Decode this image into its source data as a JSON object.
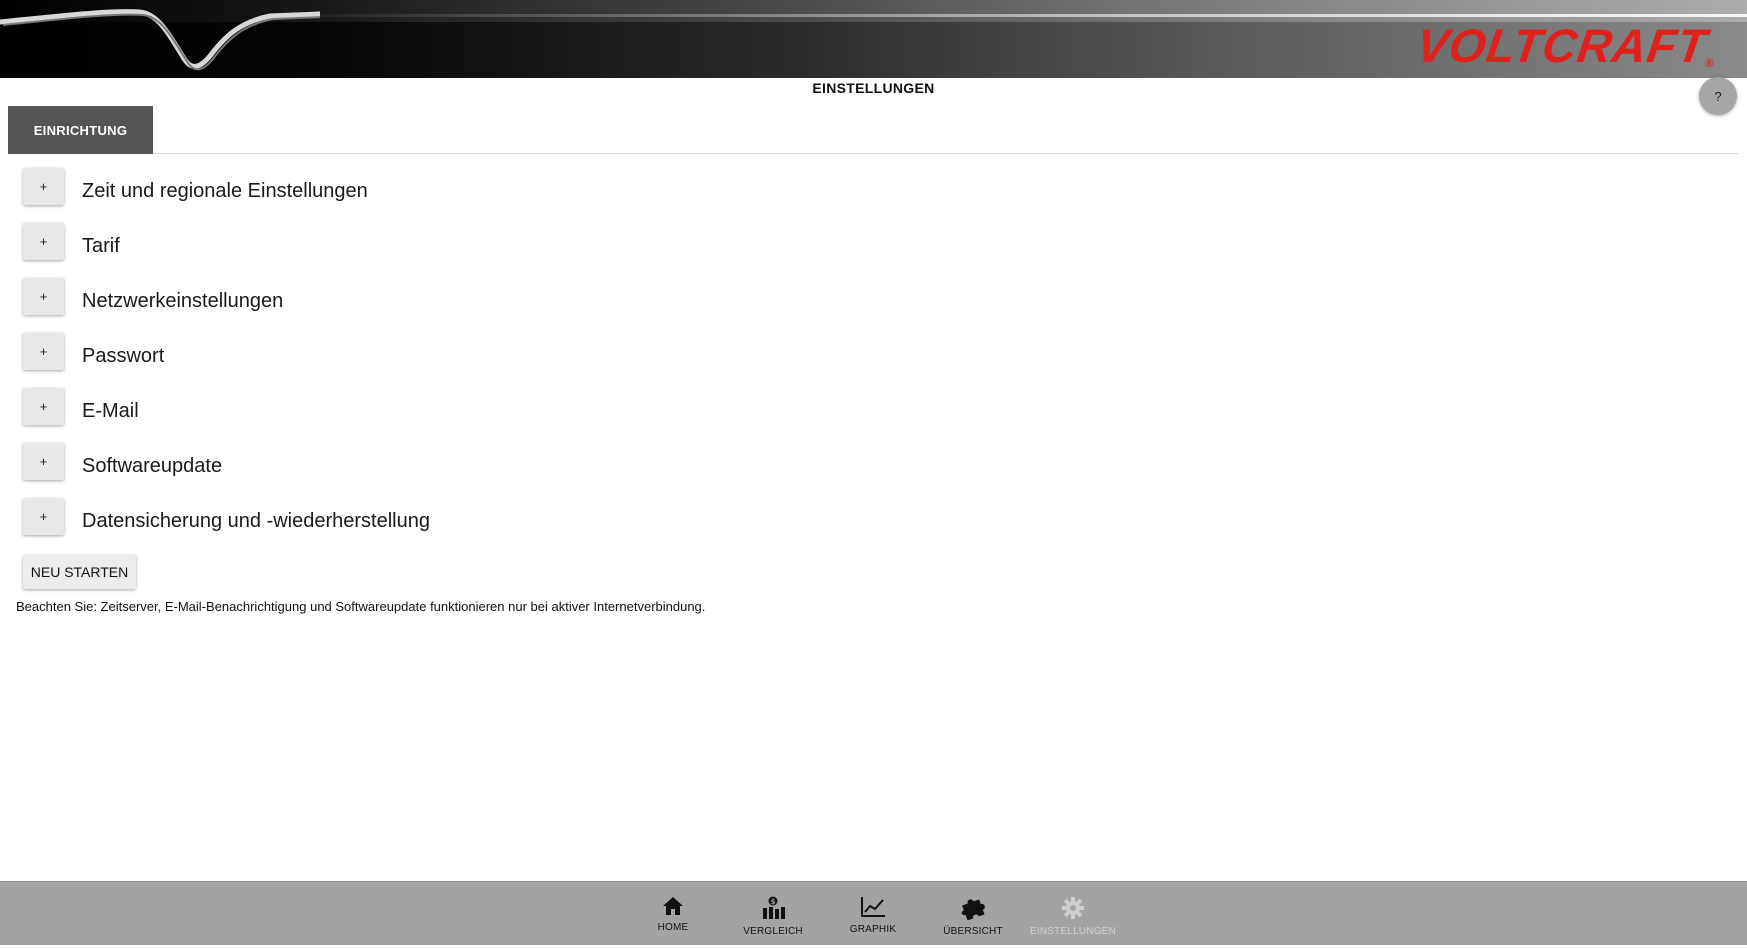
{
  "header": {
    "brand": "VOLTCRAFT",
    "brand_mark": "®",
    "brand_color": "#e0201b"
  },
  "page": {
    "title": "EINSTELLUNGEN",
    "help_label": "?"
  },
  "tabs": [
    {
      "label": "EINRICHTUNG",
      "active": true
    }
  ],
  "sections": [
    {
      "toggle": "+",
      "label": "Zeit und regionale Einstellungen"
    },
    {
      "toggle": "+",
      "label": "Tarif"
    },
    {
      "toggle": "+",
      "label": "Netzwerkeinstellungen"
    },
    {
      "toggle": "+",
      "label": "Passwort"
    },
    {
      "toggle": "+",
      "label": "E-Mail"
    },
    {
      "toggle": "+",
      "label": "Softwareupdate"
    },
    {
      "toggle": "+",
      "label": "Datensicherung und -wiederherstellung"
    }
  ],
  "actions": {
    "restart_label": "NEU STARTEN"
  },
  "note": "Beachten Sie: Zeitserver, E-Mail-Benachrichtigung und Softwareupdate funktionieren nur bei aktiver Internetverbindung.",
  "bottom_nav": [
    {
      "label": "HOME",
      "icon": "home-icon"
    },
    {
      "label": "VERGLEICH",
      "icon": "comparison-icon"
    },
    {
      "label": "GRAPHIK",
      "icon": "chart-icon"
    },
    {
      "label": "ÜBERSICHT",
      "icon": "puzzle-icon"
    },
    {
      "label": "EINSTELLUNGEN",
      "icon": "gear-icon",
      "active": true
    }
  ]
}
